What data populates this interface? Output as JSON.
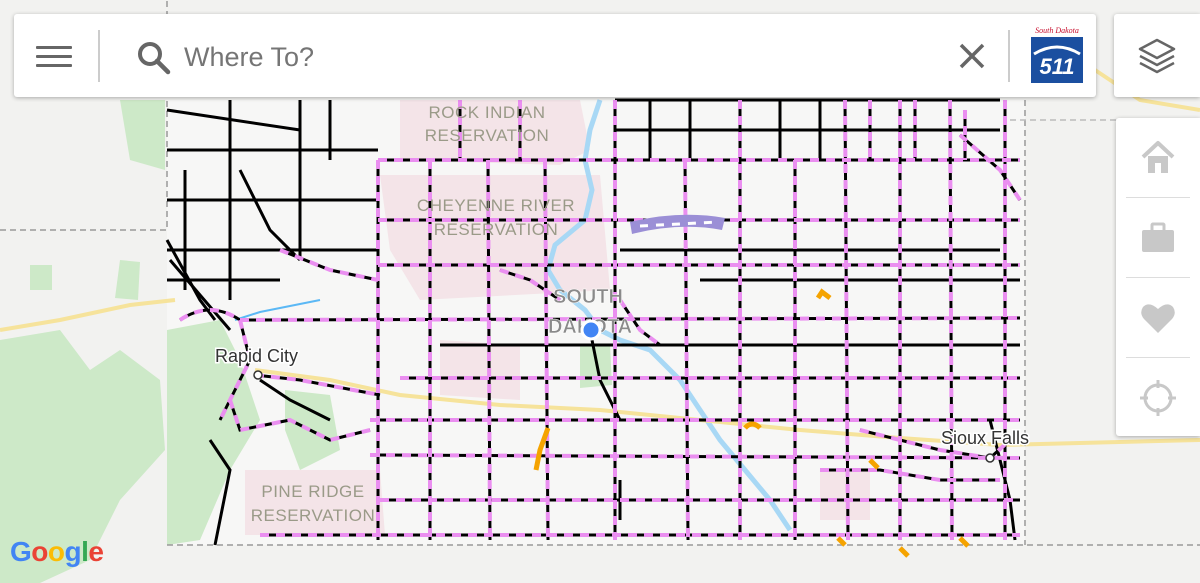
{
  "search": {
    "placeholder": "Where To?"
  },
  "logo": {
    "brand_script": "South Dakota",
    "number": "511"
  },
  "map": {
    "labels": {
      "rock_indian_1": "ROCK INDIAN",
      "rock_indian_2": "RESERVATION",
      "cheyenne_1": "CHEYENNE RIVER",
      "cheyenne_2": "RESERVATION",
      "state_1": "SOUTH",
      "state_2": "DAKOTA",
      "rapid_city": "Rapid City",
      "sioux_falls": "Sioux Falls",
      "pine_ridge_1": "PINE RIDGE",
      "pine_ridge_2": "RESERVATION"
    },
    "attribution": "Google"
  },
  "colors": {
    "road_condition_pink": "#ea8ff0",
    "road_black": "#000000",
    "construction_orange": "#f5a300",
    "closure_purple": "#9b8fd6",
    "water_blue": "#a8d8f5",
    "park_green": "#cde9c8",
    "reservation_pink": "#f4e4e8",
    "location_blue": "#4285f4"
  },
  "icons": [
    "menu-icon",
    "search-icon",
    "close-icon",
    "layers-icon",
    "home-icon",
    "briefcase-icon",
    "heart-icon",
    "crosshair-icon"
  ]
}
